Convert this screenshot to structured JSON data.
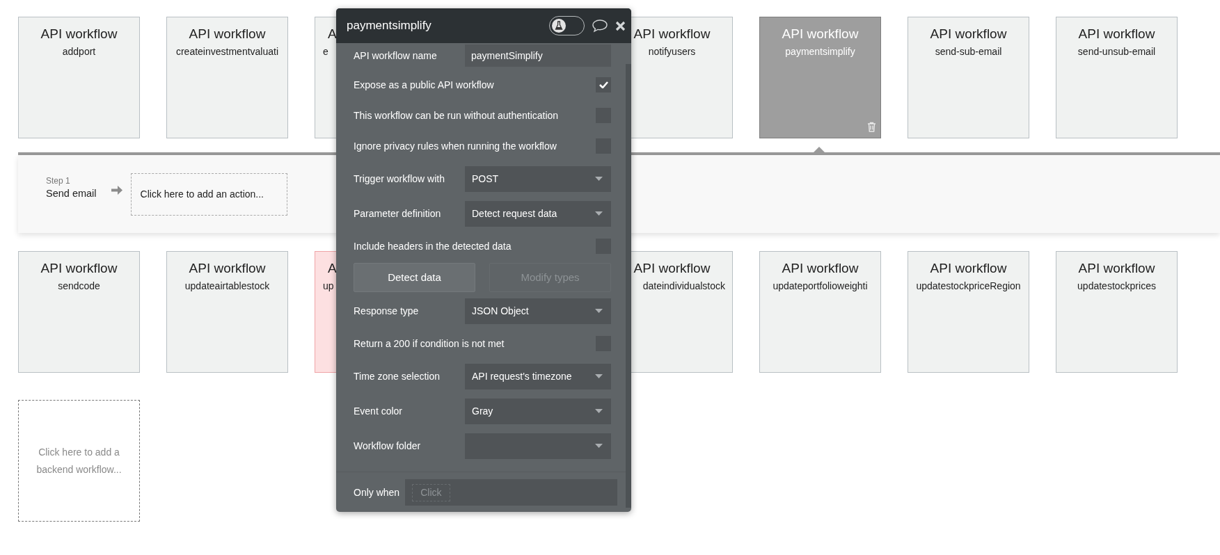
{
  "cards_top": [
    {
      "title": "API workflow",
      "subtitle": "addport",
      "selected": false,
      "flagged": false,
      "kind": "full"
    },
    {
      "title": "API workflow",
      "subtitle": "createinvestmentvaluati",
      "selected": false,
      "flagged": false,
      "kind": "full"
    },
    {
      "title": "A",
      "subtitle": "e",
      "selected": false,
      "flagged": false,
      "kind": "cut_right"
    },
    {
      "title": "API workflow",
      "subtitle": "notifyusers",
      "selected": false,
      "flagged": false,
      "kind": "full"
    },
    {
      "title": "API workflow",
      "subtitle": "paymentsimplify",
      "selected": true,
      "flagged": false,
      "kind": "full"
    },
    {
      "title": "API workflow",
      "subtitle": "send-sub-email",
      "selected": false,
      "flagged": false,
      "kind": "full"
    },
    {
      "title": "API workflow",
      "subtitle": "send-unsub-email",
      "selected": false,
      "flagged": false,
      "kind": "full"
    }
  ],
  "step": {
    "label": "Step 1",
    "name": "Send email",
    "action_placeholder": "Click here to add an action..."
  },
  "cards_bottom": [
    {
      "title": "API workflow",
      "subtitle": "sendcode",
      "selected": false,
      "flagged": false,
      "kind": "full"
    },
    {
      "title": "API workflow",
      "subtitle": "updateairtablestock",
      "selected": false,
      "flagged": false,
      "kind": "full"
    },
    {
      "title": "A",
      "subtitle": "up",
      "selected": false,
      "flagged": true,
      "kind": "cut_right"
    },
    {
      "title": "API workflow",
      "subtitle": "dateindividualstock",
      "selected": false,
      "flagged": false,
      "kind": "cut_left"
    },
    {
      "title": "API workflow",
      "subtitle": "updateportfolioweighti",
      "selected": false,
      "flagged": false,
      "kind": "full"
    },
    {
      "title": "API workflow",
      "subtitle": "updatestockpriceRegion",
      "selected": false,
      "flagged": false,
      "kind": "full"
    },
    {
      "title": "API workflow",
      "subtitle": "updatestockprices",
      "selected": false,
      "flagged": false,
      "kind": "full"
    }
  ],
  "add_card": "Click here to add a backend workflow...",
  "panel": {
    "title": "paymentsimplify",
    "test_mode": false,
    "rows": [
      {
        "kind": "text",
        "label": "API workflow name",
        "value": "paymentSimplify"
      },
      {
        "kind": "checkbox",
        "label": "Expose as a public API workflow",
        "checked": true
      },
      {
        "kind": "checkbox",
        "label": "This workflow can be run without authentication",
        "checked": false
      },
      {
        "kind": "checkbox",
        "label": "Ignore privacy rules when running the workflow",
        "checked": false
      },
      {
        "kind": "select",
        "label": "Trigger workflow with",
        "value": "POST"
      },
      {
        "kind": "select",
        "label": "Parameter definition",
        "value": "Detect request data"
      },
      {
        "kind": "checkbox",
        "label": "Include headers in the detected data",
        "checked": false
      },
      {
        "kind": "buttons",
        "buttons": [
          {
            "label": "Detect data",
            "disabled": false
          },
          {
            "label": "Modify types",
            "disabled": true
          }
        ]
      },
      {
        "kind": "select",
        "label": "Response type",
        "value": "JSON Object"
      },
      {
        "kind": "checkbox",
        "label": "Return a 200 if condition is not met",
        "checked": false
      },
      {
        "kind": "select",
        "label": "Time zone selection",
        "value": "API request's timezone"
      },
      {
        "kind": "select",
        "label": "Event color",
        "value": "Gray"
      },
      {
        "kind": "select",
        "label": "Workflow folder"
      }
    ],
    "only_when": {
      "label": "Only when",
      "placeholder": "Click"
    }
  }
}
